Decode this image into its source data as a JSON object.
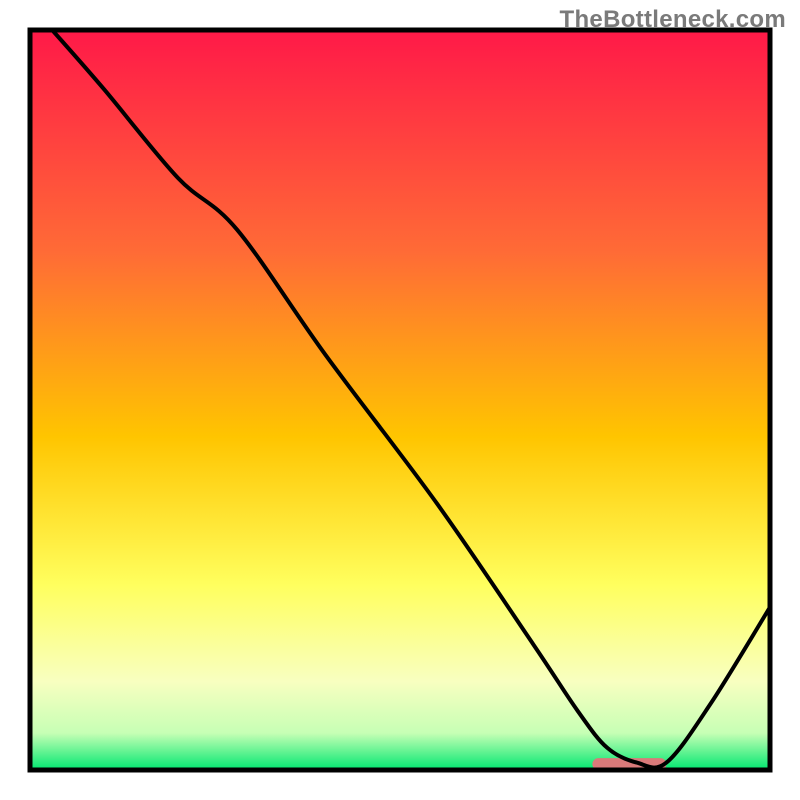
{
  "watermark": "TheBottleneck.com",
  "chart_data": {
    "type": "line",
    "title": "",
    "xlabel": "",
    "ylabel": "",
    "xlim": [
      0,
      100
    ],
    "ylim": [
      0,
      100
    ],
    "background_gradient": {
      "stops": [
        {
          "offset": 0.0,
          "color": "#ff1948"
        },
        {
          "offset": 0.3,
          "color": "#ff6b36"
        },
        {
          "offset": 0.55,
          "color": "#ffc500"
        },
        {
          "offset": 0.75,
          "color": "#ffff5e"
        },
        {
          "offset": 0.88,
          "color": "#f8ffc0"
        },
        {
          "offset": 0.95,
          "color": "#c7ffb5"
        },
        {
          "offset": 1.0,
          "color": "#00e770"
        }
      ]
    },
    "series": [
      {
        "name": "curve",
        "color": "#000000",
        "x": [
          3,
          10,
          20,
          28,
          40,
          55,
          68,
          74,
          78,
          82,
          86,
          92,
          100
        ],
        "y": [
          100,
          92,
          80,
          73,
          56,
          36,
          17,
          8,
          3,
          1,
          1,
          9,
          22
        ]
      }
    ],
    "marker": {
      "name": "highlight-bar",
      "color": "#d97a7a",
      "x_start": 76,
      "x_end": 86,
      "y": 0.8,
      "thickness": 1.6
    },
    "frame_color": "#000000",
    "frame_width": 5
  }
}
